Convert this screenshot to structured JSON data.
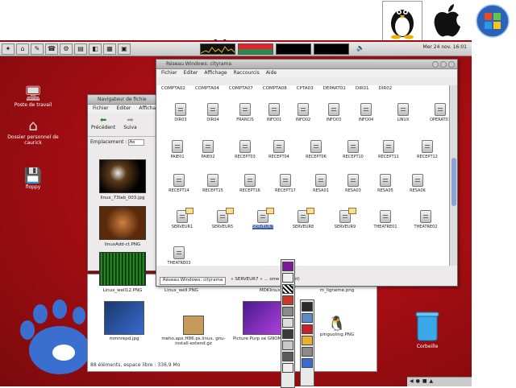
{
  "panel": {
    "clock": "Mer 24 nov. 16:01"
  },
  "title_glyphs": "ı ı",
  "desktop_icons": [
    {
      "label": "Poste de travail"
    },
    {
      "label": "Dossier personnel de caurick"
    },
    {
      "label": "floppy"
    }
  ],
  "trash": {
    "label": "Corbeille"
  },
  "nav_window": {
    "title": "Navigateur de fichie",
    "menu": [
      "Fichier",
      "Editer",
      "Afficha"
    ],
    "toolbar": {
      "back": "Précédent",
      "next": "Suiva"
    },
    "location_label": "Emplacement :",
    "location_value": "/ho",
    "files": [
      {
        "name": "linux_73lab_003.jpg"
      },
      {
        "name": "linuxAdd-ct.PNG"
      },
      {
        "name": "Linux_well12.PNG"
      },
      {
        "name": "Linux_well.PNG"
      },
      {
        "name": "MDKlinux.jpg"
      },
      {
        "name": "m_ligneme.png"
      },
      {
        "name": "mmnrepd.jpg"
      },
      {
        "name": "meho.apx.H86.ps.linux. gnu-install-extend.gz"
      },
      {
        "name": "Picture Purp se GNOME.jpg"
      },
      {
        "name": "pinguoling.PNG"
      }
    ],
    "status": "88 éléments, espace libre : 336,9 Mo"
  },
  "net_window": {
    "title": "Réseau Windows: cityrama",
    "menu": [
      "Fichier",
      "Editer",
      "Affichage",
      "Raccourcis",
      "Aide"
    ],
    "top_row": [
      "COMPTA02",
      "COMPTA04",
      "COMPTA07",
      "COMPTA08",
      "CPTA03",
      "DEPART01",
      "DIR01",
      "DIR02"
    ],
    "folders": [
      "DIR03",
      "DIR04",
      "FRANCIS",
      "INFO01",
      "INFO02",
      "INFO03",
      "INFO04",
      "LINUX",
      "OPERAT01",
      "PAIE01",
      "PAIE02",
      "RECEPT03",
      "RECEPT04",
      "RECEPT06",
      "RECEPT10",
      "RECEPT11",
      "RECEPT12",
      "RECEPT14",
      "RECEPT15",
      "RECEPT16",
      "RECEPT17",
      "RESA01",
      "RESA03",
      "RESA05",
      "RESA06",
      "SERVEUR1",
      "SERVEUR5",
      "SERVEUR7",
      "SERVEUR8",
      "SERVEUR9",
      "THEATRE01",
      "THEATRE02",
      "THEATRE03"
    ],
    "status_combo": "Réseau Windows: cityrama",
    "status_text": "« SERVEUR7 » ... ome (0 octet)"
  }
}
